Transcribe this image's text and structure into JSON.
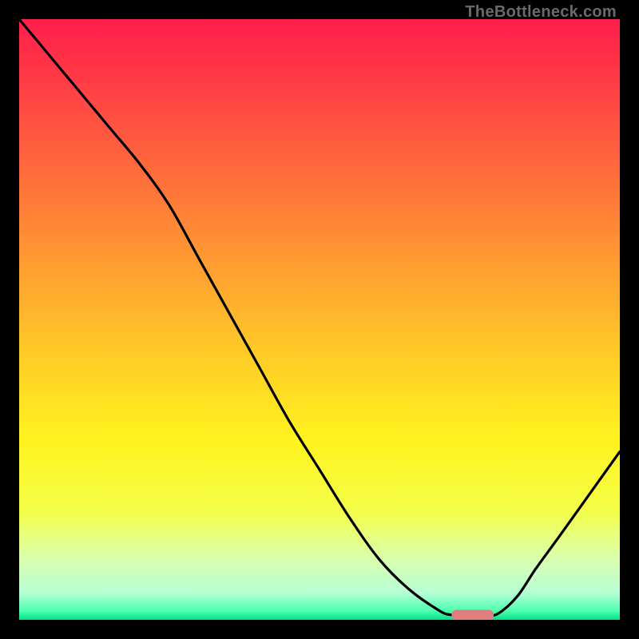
{
  "watermark": "TheBottleneck.com",
  "chart_data": {
    "type": "line",
    "title": "",
    "xlabel": "",
    "ylabel": "",
    "xlim": [
      0,
      100
    ],
    "ylim": [
      0,
      100
    ],
    "grid": false,
    "series": [
      {
        "name": "curve",
        "x": [
          0,
          5,
          10,
          15,
          20,
          25,
          30,
          35,
          40,
          45,
          50,
          55,
          60,
          65,
          70,
          72,
          75,
          78,
          80,
          83,
          86,
          90,
          95,
          100
        ],
        "y": [
          100,
          94,
          88,
          82,
          76,
          69,
          60,
          51,
          42,
          33,
          25,
          17,
          10,
          5,
          1.5,
          0.8,
          0.5,
          0.6,
          1.2,
          4,
          8.5,
          14,
          21,
          28
        ]
      }
    ],
    "marker": {
      "x_range": [
        72,
        79
      ],
      "y": 0.8,
      "color": "#df7f7d"
    },
    "background_gradient": {
      "stops": [
        {
          "offset": 0.0,
          "color": "#ff1f4b"
        },
        {
          "offset": 0.1,
          "color": "#ff3b46"
        },
        {
          "offset": 0.25,
          "color": "#ff6a3c"
        },
        {
          "offset": 0.4,
          "color": "#ff9a32"
        },
        {
          "offset": 0.55,
          "color": "#ffc928"
        },
        {
          "offset": 0.7,
          "color": "#fff31f"
        },
        {
          "offset": 0.82,
          "color": "#f4ff4a"
        },
        {
          "offset": 0.9,
          "color": "#d9ffb0"
        },
        {
          "offset": 0.955,
          "color": "#b6ffd4"
        },
        {
          "offset": 0.985,
          "color": "#4dffb0"
        },
        {
          "offset": 1.0,
          "color": "#00e08a"
        }
      ]
    }
  }
}
